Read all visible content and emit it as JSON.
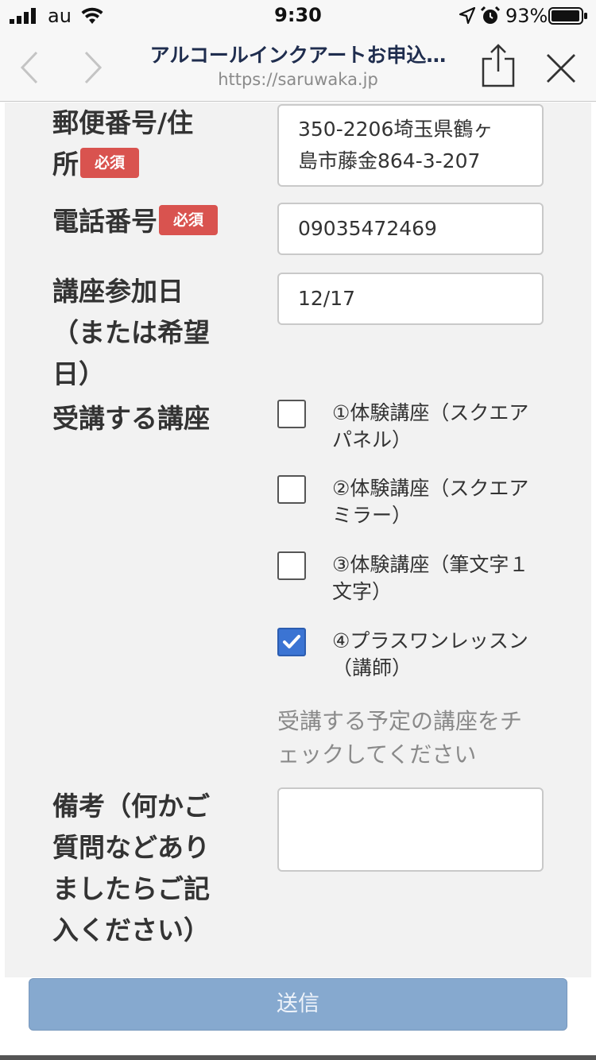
{
  "status_bar": {
    "carrier": "au",
    "time": "9:30",
    "battery": "93%",
    "icons": [
      "signal-icon",
      "wifi-icon",
      "location-icon",
      "alarm-icon",
      "battery-icon"
    ]
  },
  "browser": {
    "title": "アルコールインクアートお申込…",
    "url": "https://saruwaka.jp",
    "icons": [
      "back-icon",
      "forward-icon",
      "share-icon",
      "close-icon"
    ]
  },
  "required_badge": "必須",
  "form": {
    "address": {
      "label_line1": "郵便番号/住",
      "label_line2": "所",
      "value_line1": "350-2206埼玉県鶴ヶ",
      "value_line2": "島市藤金864-3-207"
    },
    "phone": {
      "label": "電話番号",
      "value": "09035472469"
    },
    "date": {
      "label_line1": "講座参加日",
      "label_line2": "（または希望",
      "label_line3": "日）",
      "value": "12/17"
    },
    "courses": {
      "label": "受講する講座",
      "options": [
        {
          "line1": "①体験講座（スクエア",
          "line2": "パネル）",
          "checked": false
        },
        {
          "line1": "②体験講座（スクエア",
          "line2": "ミラー）",
          "checked": false
        },
        {
          "line1": "③体験講座（筆文字１",
          "line2": "文字）",
          "checked": false
        },
        {
          "line1": "④プラスワンレッスン",
          "line2": "（講師）",
          "checked": true
        }
      ],
      "help_line1": "受講する予定の講座をチ",
      "help_line2": "ェックしてください"
    },
    "notes": {
      "label_line1": "備考（何かご",
      "label_line2": "質問などあり",
      "label_line3": "ましたらご記",
      "label_line4": "入ください）",
      "value": ""
    },
    "submit_label": "送信"
  },
  "colors": {
    "required_badge": "#d9534f",
    "checkbox_checked": "#3b74d3",
    "submit_button": "#86a9cf",
    "form_background": "#f2f2f2"
  }
}
